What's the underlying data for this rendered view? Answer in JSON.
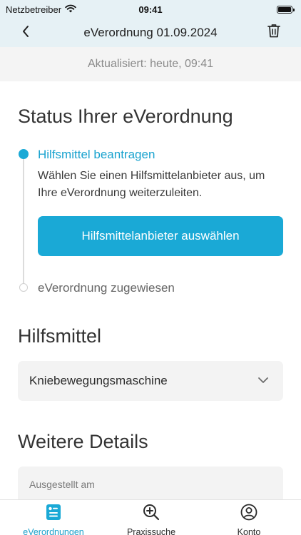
{
  "status_bar": {
    "carrier": "Netzbetreiber",
    "time": "09:41",
    "icons": [
      "wifi-icon",
      "battery-icon"
    ]
  },
  "header": {
    "title": "eVerordnung 01.09.2024",
    "back_icon": "chevron-left-icon",
    "delete_icon": "trash-icon"
  },
  "banner": {
    "updated_text": "Aktualisiert: heute, 09:41"
  },
  "status_section": {
    "title": "Status Ihrer eVerordnung",
    "steps": [
      {
        "label": "Hilfsmittel beantragen",
        "state": "active",
        "description": "Wählen Sie einen Hilfsmittelanbieter aus, um Ihre eVerordnung weiterzuleiten.",
        "action_label": "Hilfsmittelanbieter auswählen"
      },
      {
        "label": "eVerordnung zugewiesen",
        "state": "pending"
      }
    ]
  },
  "aid_section": {
    "title": "Hilfsmittel",
    "selected_value": "Kniebewegungsmaschine",
    "chevron_icon": "chevron-down-icon"
  },
  "details_section": {
    "title": "Weitere Details",
    "issued_label": "Ausgestellt am"
  },
  "tab_bar": {
    "tabs": [
      {
        "label": "eVerordnungen",
        "icon": "document-icon",
        "active": true
      },
      {
        "label": "Praxissuche",
        "icon": "search-plus-icon",
        "active": false
      },
      {
        "label": "Konto",
        "icon": "user-icon",
        "active": false
      }
    ]
  },
  "colors": {
    "accent": "#1aa9d6",
    "header_bg": "#e6f1f5",
    "banner_bg": "#f4f4f4",
    "card_bg": "#f3f3f3"
  }
}
